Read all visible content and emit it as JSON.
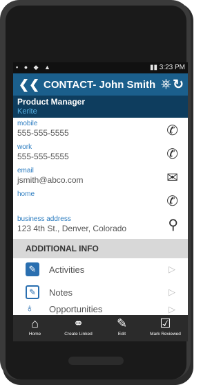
{
  "status_bar": {
    "time": "3:23 PM"
  },
  "header": {
    "title": "CONTACT- John Smith",
    "back_icon": "double-chevron-left-icon",
    "action_icons": [
      "share-icon",
      "refresh-icon"
    ]
  },
  "contact": {
    "role": "Product Manager",
    "company": "Kerite",
    "fields": [
      {
        "label": "mobile",
        "value": "555-555-5555",
        "icon": "phone-icon"
      },
      {
        "label": "work",
        "value": "555-555-5555",
        "icon": "phone-icon"
      },
      {
        "label": "email",
        "value": "jsmith@abco.com",
        "icon": "mail-icon"
      },
      {
        "label": "home",
        "value": "",
        "icon": "phone-icon"
      },
      {
        "label": "business address",
        "value": "123 4th St., Denver, Colorado",
        "icon": "map-pin-icon"
      }
    ]
  },
  "additional_info": {
    "title": "ADDITIONAL INFO",
    "items": [
      {
        "label": "Activities",
        "icon": "pencil-square-icon"
      },
      {
        "label": "Notes",
        "icon": "edit-note-icon"
      },
      {
        "label": "Opportunities",
        "icon": "lightbulb-icon"
      }
    ]
  },
  "toolbar": {
    "items": [
      {
        "label": "Home",
        "icon": "home-icon"
      },
      {
        "label": "Create Linked",
        "icon": "link-icon"
      },
      {
        "label": "Edit",
        "icon": "edit-icon"
      },
      {
        "label": "Mark Reviewed",
        "icon": "checklist-icon"
      }
    ]
  },
  "colors": {
    "header": "#1b5f8c",
    "subheader": "#0e3d5e",
    "accent": "#2a7bbf",
    "section": "#d8d8d8",
    "toolbar": "#2b2b2b"
  }
}
